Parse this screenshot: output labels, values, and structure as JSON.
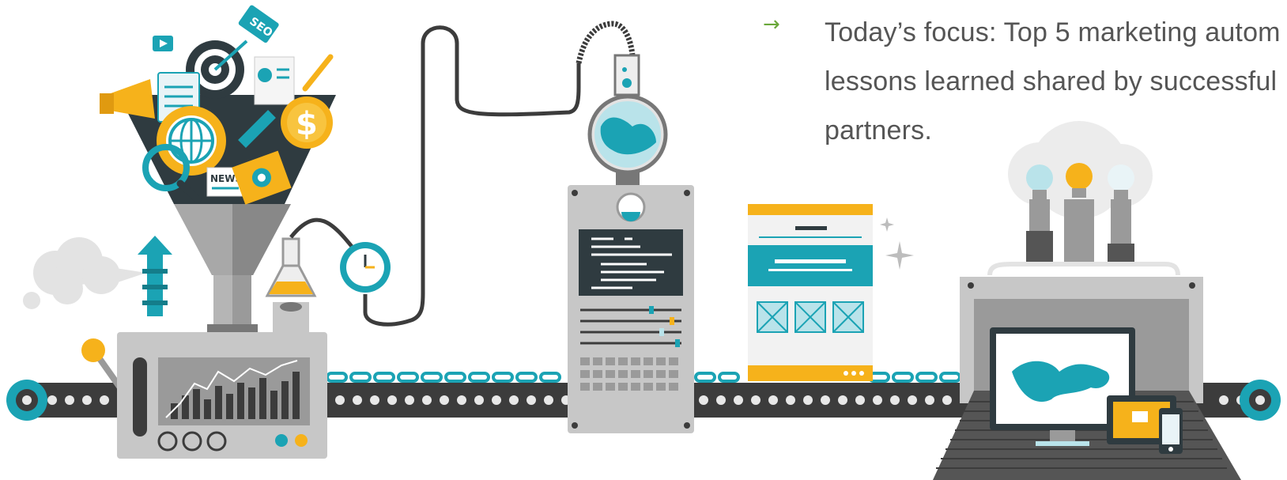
{
  "focus": {
    "arrow": "→",
    "lines": [
      "Today’s focus: Top 5 marketing autom",
      "lessons learned shared by successful",
      "partners."
    ]
  },
  "labels": {
    "seo_tag": "SEO",
    "news": "NEWS",
    "dollar": "$"
  },
  "colors": {
    "teal": "#1ba3b4",
    "yellow": "#f6b21b",
    "dark": "#3c3c3c",
    "grey": "#c7c7c7",
    "green_arrow": "#6aa83a"
  }
}
